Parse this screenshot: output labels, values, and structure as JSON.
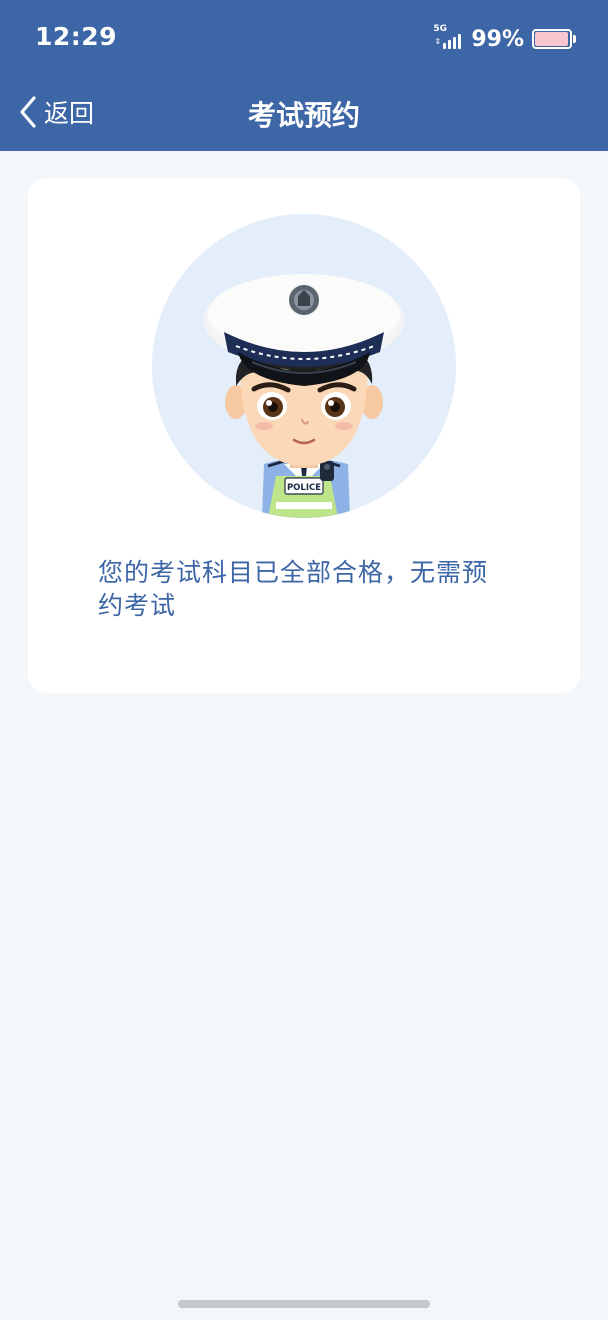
{
  "status_bar": {
    "time": "12:29",
    "network": "5G",
    "battery_percent": "99%",
    "battery_level": 0.99
  },
  "header": {
    "back_label": "返回",
    "title": "考试预约"
  },
  "card": {
    "avatar_badge_text": "POLICE",
    "message": "您的考试科目已全部合格，无需预约考试"
  },
  "colors": {
    "header_bg": "#3d66a6",
    "page_bg": "#f3f7f9",
    "card_bg": "#ffffff",
    "message_text": "#3d66a6",
    "avatar_circle": "#e4eefb"
  },
  "icons": {
    "back": "chevron-left-icon",
    "signal": "signal-icon",
    "battery": "battery-icon"
  }
}
